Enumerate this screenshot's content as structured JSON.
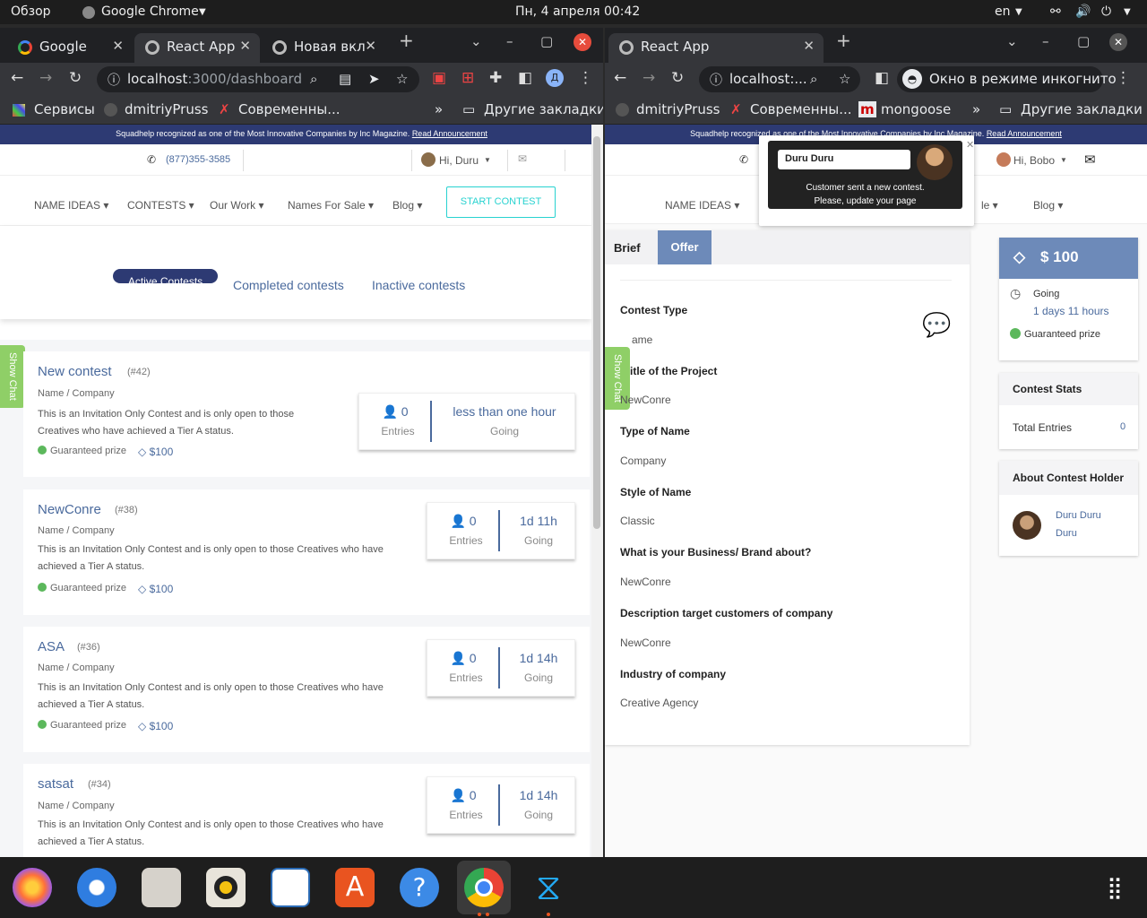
{
  "system_bar": {
    "activities": "Обзор",
    "app": "Google Chrome",
    "clock": "Пн, 4 апреля  00:42",
    "lang": "en"
  },
  "left_window": {
    "tabs": [
      {
        "label": "Google"
      },
      {
        "label": "React App"
      },
      {
        "label": "Новая вкл"
      }
    ],
    "url_host": "localhost",
    "url_path": ":3000/dashboard",
    "bookmarks": [
      "Сервисы",
      "dmitriyPruss",
      "Современны...",
      "Другие закладки"
    ],
    "site": {
      "banner_text": "Squadhelp recognized as one of the Most Innovative Companies by Inc Magazine.",
      "banner_link": "Read Announcement",
      "phone": "(877)355-3585",
      "greeting": "Hi, Duru",
      "nav": [
        "NAME IDEAS",
        "CONTESTS",
        "Our Work",
        "Names For Sale",
        "Blog"
      ],
      "start_contest": "START CONTEST",
      "filters": {
        "active": "Active Contests",
        "completed": "Completed contests",
        "inactive": "Inactive contests"
      },
      "show_chat": "Show Chat",
      "contests": [
        {
          "name": "New contest",
          "num": "(#42)",
          "type": "Name / Company",
          "desc1": "This is an Invitation Only Contest and is only open to those",
          "desc2": "Creatives who have achieved a Tier A status.",
          "guaranteed": "Guaranteed prize",
          "prize": "$100",
          "entries": "0",
          "entries_label": "Entries",
          "time": "less than one hour",
          "time_label": "Going"
        },
        {
          "name": "NewConre",
          "num": "(#38)",
          "type": "Name / Company",
          "desc1": "This is an Invitation Only Contest and is only open to those Creatives who have",
          "desc2": "achieved a Tier A status.",
          "guaranteed": "Guaranteed prize",
          "prize": "$100",
          "entries": "0",
          "entries_label": "Entries",
          "time": "1d 11h",
          "time_label": "Going"
        },
        {
          "name": "ASA",
          "num": "(#36)",
          "type": "Name / Company",
          "desc1": "This is an Invitation Only Contest and is only open to those Creatives who have",
          "desc2": "achieved a Tier A status.",
          "guaranteed": "Guaranteed prize",
          "prize": "$100",
          "entries": "0",
          "entries_label": "Entries",
          "time": "1d 14h",
          "time_label": "Going"
        },
        {
          "name": "satsat",
          "num": "(#34)",
          "type": "Name / Company",
          "desc1": "This is an Invitation Only Contest and is only open to those Creatives who have",
          "desc2": "achieved a Tier A status.",
          "guaranteed": "",
          "prize": "",
          "entries": "0",
          "entries_label": "Entries",
          "time": "1d 14h",
          "time_label": "Going"
        }
      ]
    }
  },
  "right_window": {
    "tabs": [
      {
        "label": "React App"
      }
    ],
    "url": "localhost:...",
    "incognito": "Окно в режиме инкогнито",
    "bookmarks": [
      "dmitriyPruss",
      "Современны...",
      "mongoose",
      "Другие закладки"
    ],
    "site": {
      "banner_text": "Squadhelp recognized as one of the Most Innovative Companies by Inc Magazine.",
      "banner_link": "Read Announcement",
      "greeting": "Hi, Bobo",
      "nav": [
        "NAME IDEAS",
        "le",
        "Blog"
      ],
      "notification": {
        "name": "Duru Duru",
        "line1": "Customer sent a new contest.",
        "line2": "Please, update your page"
      },
      "tabs": {
        "brief": "Brief",
        "offer": "Offer"
      },
      "show_chat": "Show Chat",
      "fields": [
        {
          "label": "Contest Type",
          "value": "ame"
        },
        {
          "label": "itle of the Project",
          "value": "NewConre"
        },
        {
          "label": "Type of Name",
          "value": "Company"
        },
        {
          "label": "Style of Name",
          "value": "Classic"
        },
        {
          "label": "What is your Business/ Brand about?",
          "value": "NewConre"
        },
        {
          "label": "Description target customers of company",
          "value": "NewConre"
        },
        {
          "label": "Industry of company",
          "value": "Creative Agency"
        }
      ],
      "prize": "$ 100",
      "status": "Going",
      "remaining": "1 days 11 hours",
      "guaranteed": "Guaranteed prize",
      "stats_title": "Contest Stats",
      "total_entries_label": "Total Entries",
      "total_entries": "0",
      "holder_title": "About Contest Holder",
      "holder_name1": "Duru Duru",
      "holder_name2": "Duru"
    }
  },
  "colors": {
    "brand": "#2d3a73",
    "accent": "#4a6a9d",
    "teal": "#28d2d0",
    "green": "#8fcf67"
  }
}
